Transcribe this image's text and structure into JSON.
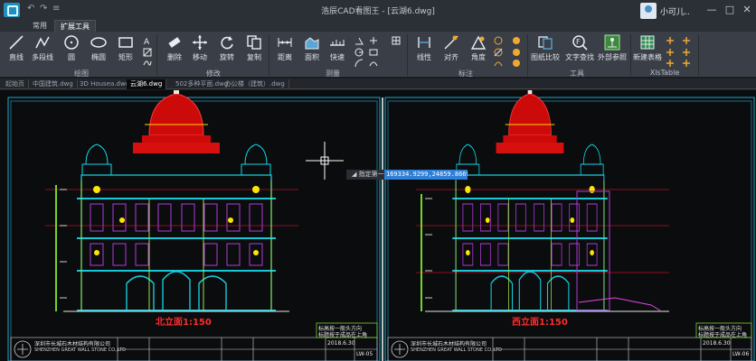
{
  "window": {
    "title": "浩辰CAD看图王 - [云湖6.dwg]",
    "user_name": "小可儿..",
    "minimize": "—",
    "maximize": "□",
    "close": "✕"
  },
  "quick_access": {
    "undo": "↶",
    "redo": "↷",
    "more": "≡"
  },
  "ribbon_tabs": [
    "常用",
    "扩展工具"
  ],
  "ribbon": {
    "groups": [
      "绘图",
      "修改",
      "测量",
      "标注",
      "工具",
      "XlsTable"
    ],
    "draw": [
      "直线",
      "多段线",
      "圆",
      "椭圆",
      "矩形"
    ],
    "modify": [
      "删除",
      "移动",
      "旋转",
      "复制"
    ],
    "measure": [
      "距离",
      "面积",
      "快速"
    ],
    "annotate": [
      "线性",
      "对齐",
      "角度"
    ],
    "tools": [
      "图纸比较",
      "文字查找",
      "外部参照"
    ],
    "xls": [
      "新建表格"
    ]
  },
  "doc_tabs": [
    "起始页",
    "中国建筑.dwg",
    "3D Housea.dwg",
    "云湖6.dwg",
    "502多种平面.dwg",
    "办公楼（建筑）.dwg"
  ],
  "active_doc_index": 3,
  "command": {
    "prompt": "指定第一点",
    "coordinates": "169334.9299,24859.8669"
  },
  "drawing": {
    "left_title": "北立面1:150",
    "right_title": "西立面1:150",
    "note_line1": "标高按一般头方向",
    "note_line2": "标题按于成品在上角",
    "company": "深圳市长城石木材结构有限公司",
    "company_en": "SHENZHEN GREAT WALL STONE CO.,LTD",
    "date": "2018.6.30",
    "sheet_left": "LW-05",
    "sheet_right": "LW-06"
  }
}
